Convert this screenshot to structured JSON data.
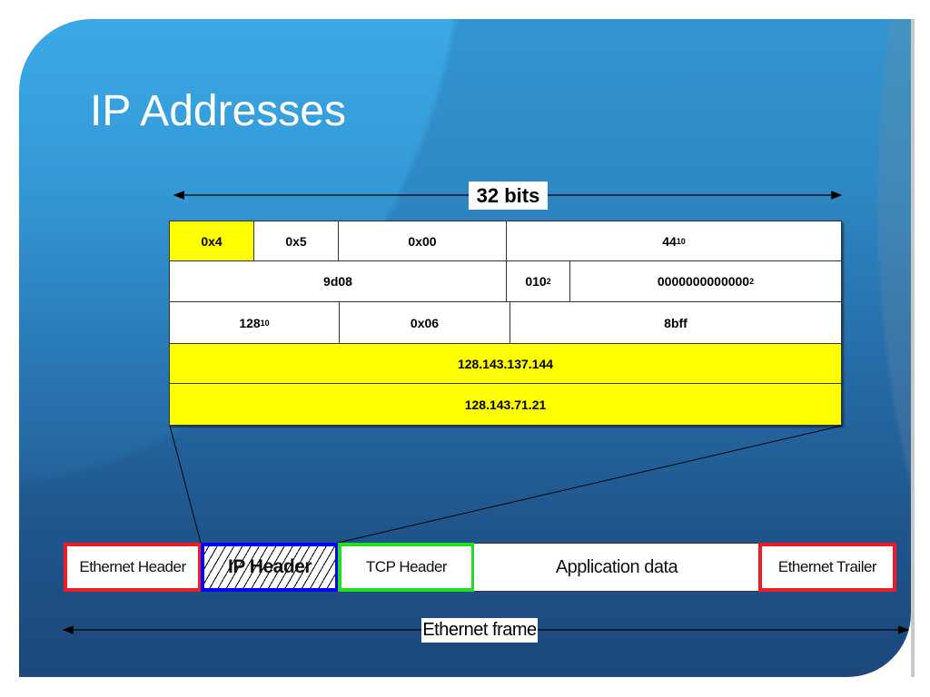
{
  "slide": {
    "title": "IP Addresses"
  },
  "header_diagram": {
    "width_label": "32 bits",
    "rows": [
      [
        {
          "value": "0x4",
          "sub": "",
          "highlight": true
        },
        {
          "value": "0x5",
          "sub": "",
          "highlight": false
        },
        {
          "value": "0x00",
          "sub": "",
          "highlight": false
        },
        {
          "value": "44",
          "sub": "10",
          "highlight": false
        }
      ],
      [
        {
          "value": "9d08",
          "sub": "",
          "highlight": false
        },
        {
          "value": "010",
          "sub": "2",
          "highlight": false
        },
        {
          "value": "0000000000000",
          "sub": "2",
          "highlight": false
        }
      ],
      [
        {
          "value": "128",
          "sub": "10",
          "highlight": false
        },
        {
          "value": "0x06",
          "sub": "",
          "highlight": false
        },
        {
          "value": "8bff",
          "sub": "",
          "highlight": false
        }
      ],
      [
        {
          "value": "128.143.137.144",
          "sub": "",
          "highlight": true
        }
      ],
      [
        {
          "value": "128.143.71.21",
          "sub": "",
          "highlight": true
        }
      ]
    ]
  },
  "ethernet_frame": {
    "label": "Ethernet frame",
    "segments": [
      {
        "label": "Ethernet Header",
        "color": "#ee1c24"
      },
      {
        "label": "IP Header",
        "color": "#0000ff"
      },
      {
        "label": "TCP Header",
        "color": "#22dd22"
      },
      {
        "label": "Application data",
        "color": "#333333"
      },
      {
        "label": "Ethernet Trailer",
        "color": "#ee1c24"
      }
    ]
  },
  "colors": {
    "highlight": "#ffff00",
    "slide_top": "#3aa9e6",
    "slide_bottom": "#1e4a7e"
  }
}
